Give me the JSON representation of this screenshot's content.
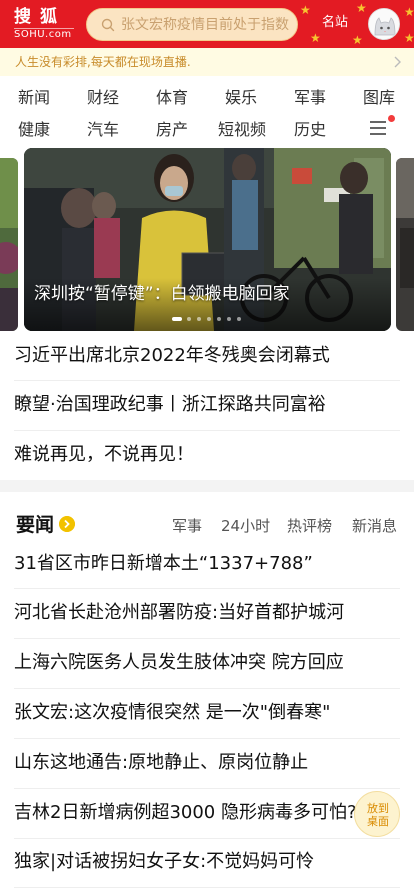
{
  "header": {
    "logo_cn": "搜狐",
    "logo_en": "SOHU.com",
    "search_placeholder": "张文宏称疫情目前处于指数",
    "mingzhan_label": "名站",
    "colors": {
      "bar": "#e31b23",
      "search_bg": "#fbe4c2",
      "star": "#f7c430"
    }
  },
  "notice": {
    "text": "人生没有彩排,每天都在现场直播."
  },
  "nav": {
    "row1": [
      "新闻",
      "财经",
      "体育",
      "娱乐",
      "军事",
      "图库"
    ],
    "row2": [
      "健康",
      "汽车",
      "房产",
      "短视频",
      "历史"
    ]
  },
  "carousel": {
    "caption": "深圳按“暂停键”：白领搬电脑回家",
    "slide_count": 7,
    "active_index": 0
  },
  "headlines": [
    "习近平出席北京2022年冬残奥会闭幕式",
    "瞭望·治国理政纪事丨浙江探路共同富裕",
    "难说再见，不说再见！"
  ],
  "section": {
    "title": "要闻",
    "tabs": [
      "军事",
      "24小时",
      "热评榜",
      "新消息"
    ]
  },
  "news": [
    "31省区市昨日新增本土“1337+788”",
    "河北省长赴沧州部署防疫:当好首都护城河",
    "上海六院医务人员发生肢体冲突 院方回应",
    "张文宏:这次疫情很突然 是一次\"倒春寒\"",
    "山东这地通告:原地静止、原岗位静止",
    "吉林2日新增病例超3000 隐形病毒多可怕?",
    "独家|对话被拐妇女子女:不觉妈妈可怜"
  ],
  "fab": {
    "line1": "放到",
    "line2": "桌面"
  }
}
